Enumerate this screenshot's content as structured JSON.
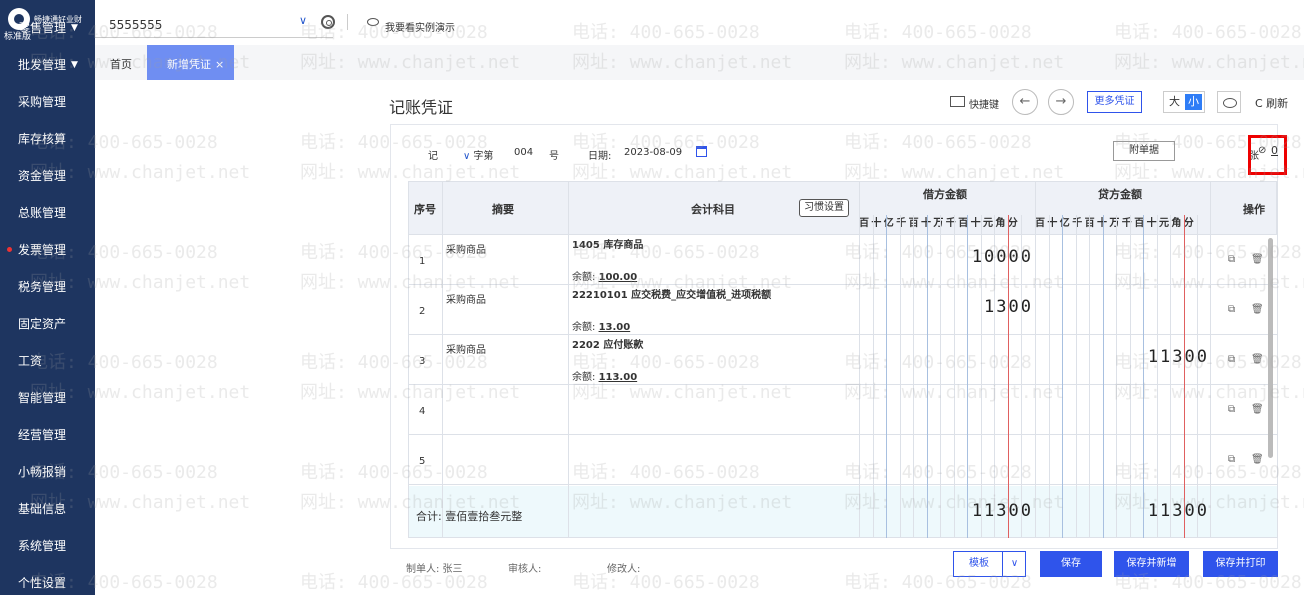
{
  "sidebar": {
    "logo_name": "畅捷通好业财",
    "edition": "标准版",
    "groups": [
      {
        "label": "零售管理",
        "caret": "▼"
      },
      {
        "label": "批发管理",
        "caret": "▼"
      },
      {
        "label": "采购管理"
      },
      {
        "label": "库存核算"
      },
      {
        "label": "资金管理"
      },
      {
        "label": "总账管理"
      },
      {
        "label": "发票管理"
      },
      {
        "label": "税务管理"
      },
      {
        "label": "固定资产"
      },
      {
        "label": "工资"
      },
      {
        "label": "智能管理"
      },
      {
        "label": "经营管理"
      },
      {
        "label": "小畅报销"
      },
      {
        "label": "基础信息"
      },
      {
        "label": "系统管理"
      },
      {
        "label": "个性设置"
      }
    ]
  },
  "topbar": {
    "account": "5555555",
    "demo_label": "我要看实例演示"
  },
  "tabs": {
    "home": "首页",
    "active": "新增凭证",
    "close": "×"
  },
  "header": {
    "title": "记账凭证",
    "shortcut_label": "快捷键",
    "prev": "←",
    "next": "→",
    "more_label": "更多凭证",
    "size_big": "大",
    "size_small": "小",
    "refresh_label": "C 刷新"
  },
  "voucher": {
    "type": "记",
    "word_label": "字第",
    "number": "004",
    "hao": "号",
    "date_label": "日期:",
    "date": "2023-08-09",
    "attach_label": "附单据",
    "attach_unit": "张",
    "attach_count": "0"
  },
  "table": {
    "headers": {
      "no": "序号",
      "summary": "摘要",
      "account": "会计科目",
      "habit": "习惯设置",
      "debit": "借方金额",
      "credit": "贷方金额",
      "ops": "操作"
    },
    "digits": "百十亿千百十万千百十元角分",
    "rows": [
      {
        "no": "1",
        "summary": "采购商品",
        "account": "1405 库存商品",
        "balance_label": "余额:",
        "balance": "100.00",
        "debit": "10000",
        "credit": ""
      },
      {
        "no": "2",
        "summary": "采购商品",
        "account": "22210101 应交税费_应交增值税_进项税额",
        "balance_label": "余额:",
        "balance": "13.00",
        "debit": "1300",
        "credit": ""
      },
      {
        "no": "3",
        "summary": "采购商品",
        "account": "2202 应付账款",
        "balance_label": "余额:",
        "balance": "113.00",
        "debit": "",
        "credit": "11300"
      },
      {
        "no": "4",
        "summary": "",
        "account": "",
        "balance_label": "",
        "balance": "",
        "debit": "",
        "credit": ""
      },
      {
        "no": "5",
        "summary": "",
        "account": "",
        "balance_label": "",
        "balance": "",
        "debit": "",
        "credit": ""
      }
    ],
    "total_label": "合计: 壹佰壹拾叁元整",
    "total_debit": "11300",
    "total_credit": "11300"
  },
  "footer": {
    "maker": "制单人: 张三",
    "auditor": "审核人:",
    "modifier": "修改人:",
    "template": "模板",
    "save": "保存",
    "save_new": "保存并新增",
    "save_print": "保存并打印"
  },
  "watermark": {
    "phone": "电话: 400-665-0028",
    "site": "网址: www.chanjet.net"
  },
  "colors": {
    "sidebar": "#1e3560",
    "accent": "#2f54eb",
    "tab_active": "#6f8ef2",
    "highlight": "#e00000"
  }
}
